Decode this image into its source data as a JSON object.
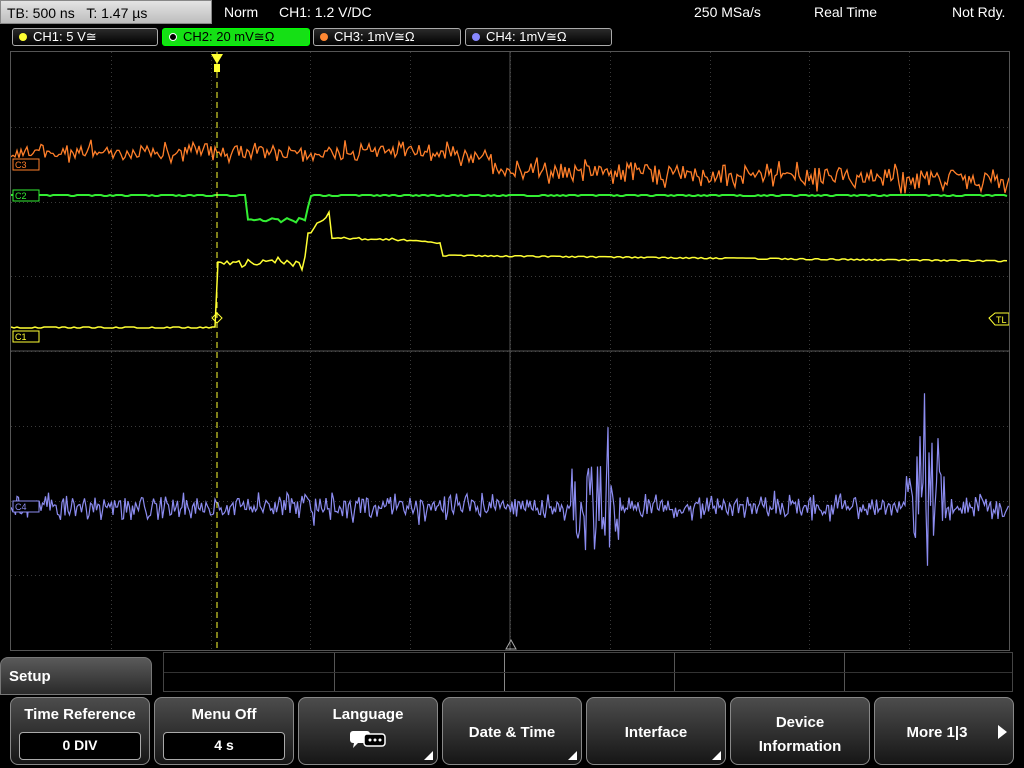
{
  "topbar": {
    "timebase": "TB: 500 ns",
    "trigger_time": "T: 1.47 µs",
    "trigger_mode": "Norm",
    "trigger_source": "CH1: 1.2 V",
    "trigger_slope_coupling": "/DC",
    "sample_rate": "250 MSa/s",
    "acq_mode": "Real Time",
    "acq_state": "Not Rdy."
  },
  "channels": [
    {
      "label": "CH1: 5 V≅",
      "color": "#ffff33",
      "active": false
    },
    {
      "label": "CH2: 20 mV≅Ω",
      "color": "#33ff33",
      "active": true
    },
    {
      "label": "CH3: 1mV≅Ω",
      "color": "#ff8833",
      "active": false
    },
    {
      "label": "CH4: 1mV≅Ω",
      "color": "#8888ff",
      "active": false
    }
  ],
  "markers": {
    "c3": "C3",
    "c2": "C2",
    "c1": "C1",
    "c4": "C4",
    "tl": "TL"
  },
  "setup_tab": "Setup",
  "softkeys": {
    "time_reference": {
      "label": "Time Reference",
      "value": "0 DIV"
    },
    "menu_off": {
      "label": "Menu Off",
      "value": "4 s"
    },
    "language": {
      "label": "Language",
      "icon": "speech-bubble-icon"
    },
    "date_time": {
      "label": "Date & Time"
    },
    "interface": {
      "label": "Interface"
    },
    "device_info": {
      "line1": "Device",
      "line2": "Information"
    },
    "more": {
      "label": "More 1|3",
      "icon": "play-arrow-icon"
    }
  },
  "colors": {
    "ch1": "#ffff33",
    "ch2": "#33ee33",
    "ch3": "#ff7f2a",
    "ch4": "#8c8cf0",
    "grid": "#444444",
    "trigger_marker": "#ffff33"
  }
}
